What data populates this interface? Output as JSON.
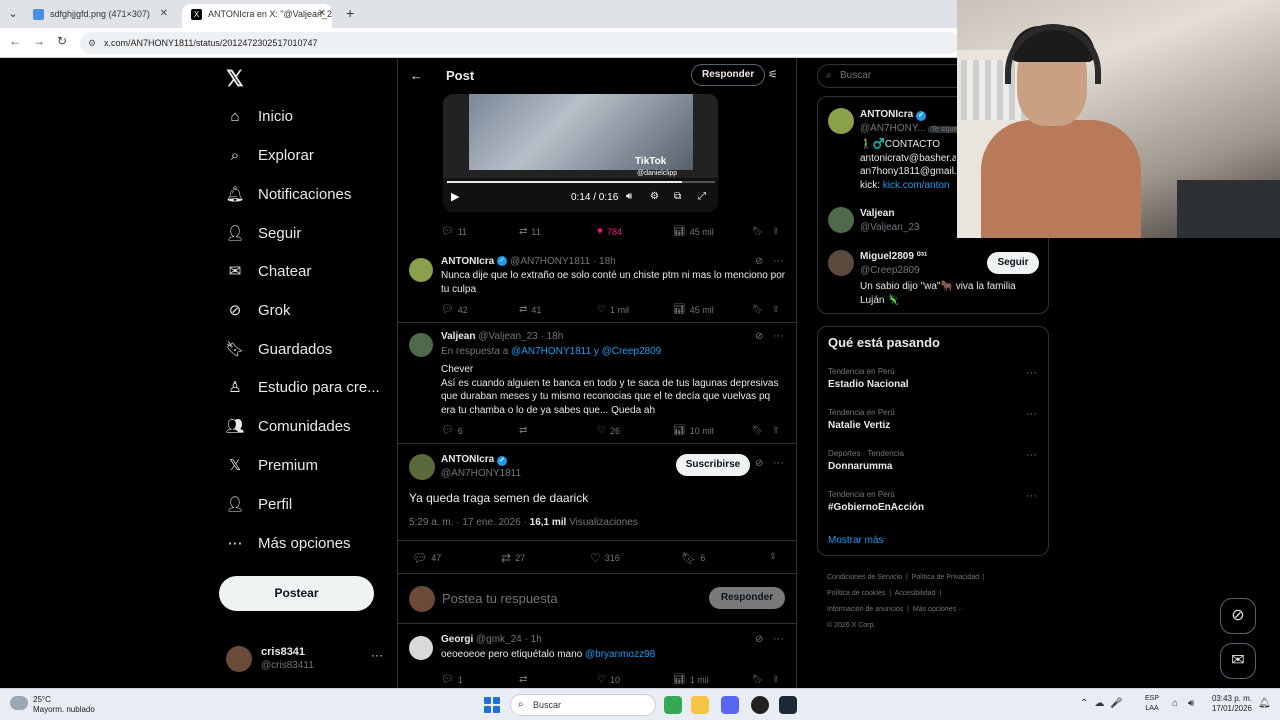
{
  "browser": {
    "tabs": [
      {
        "title": "sdfghjjgfd.png (471×307)",
        "active": false
      },
      {
        "title": "ANTONIcra en X: \"@Valjean_23",
        "active": true
      }
    ],
    "url": "x.com/AN7HONY1811/status/2012472302517010747"
  },
  "nav": {
    "items": [
      {
        "label": "Inicio",
        "icon": "home-icon",
        "glyph": "⌂"
      },
      {
        "label": "Explorar",
        "icon": "search-icon",
        "glyph": "⌕"
      },
      {
        "label": "Notificaciones",
        "icon": "bell-icon",
        "glyph": "🔔︎"
      },
      {
        "label": "Seguir",
        "icon": "add-user-icon",
        "glyph": "👤︎"
      },
      {
        "label": "Chatear",
        "icon": "mail-icon",
        "glyph": "✉"
      },
      {
        "label": "Grok",
        "icon": "grok-icon",
        "glyph": "⊘"
      },
      {
        "label": "Guardados",
        "icon": "bookmark-icon",
        "glyph": "🔖︎"
      },
      {
        "label": "Estudio para cre...",
        "icon": "studio-icon",
        "glyph": "♙"
      },
      {
        "label": "Comunidades",
        "icon": "communities-icon",
        "glyph": "👥︎"
      },
      {
        "label": "Premium",
        "icon": "x-icon",
        "glyph": "𝕏"
      },
      {
        "label": "Perfil",
        "icon": "profile-icon",
        "glyph": "👤︎"
      },
      {
        "label": "Más opciones",
        "icon": "more-circle-icon",
        "glyph": "⋯"
      }
    ],
    "post_button": "Postear",
    "me": {
      "name": "cris8341",
      "handle": "@cris83411"
    }
  },
  "header": {
    "title": "Post",
    "reply_button": "Responder"
  },
  "video": {
    "tiktok": "TikTok",
    "tiktok_handle": "@danielclipp",
    "time": "0:14 / 0:16",
    "progress": 0.875
  },
  "video_actions": {
    "replies": "11",
    "reposts": "11",
    "likes": "784",
    "views": "45 mil"
  },
  "tweets": [
    {
      "name": "ANTONIcra",
      "handle": "@AN7HONY1811 · 18h",
      "text": "Nunca dije que lo extraño oe solo conté un chiste ptm ni mas lo menciono por tu culpa",
      "replies": "42",
      "reposts": "41",
      "likes": "1 mil",
      "views": "45 mil"
    },
    {
      "name": "Valjean",
      "handle": "@Valjean_23 · 18h",
      "reply_prefix": "En respuesta a",
      "reply_users": "@AN7HONY1811 y @Creep2809",
      "text": "Chever\nAsí es cuando alguien te banca en todo y te saca de tus lagunas depresivas que duraban meses y tu mismo reconocias que el te decía que vuelvas pq era tu chamba o lo de ya sabes que... Queda ah",
      "replies": "6",
      "reposts": "",
      "likes": "26",
      "views": "10 mil"
    }
  ],
  "main_tweet": {
    "name": "ANTONIcra",
    "handle": "@AN7HONY1811",
    "subscribe": "Suscribirse",
    "text": "Ya queda traga semen de daarick",
    "timestamp": "5:29 a. m. · 17 ene. 2026 ·",
    "views_count": "16,1 mil",
    "views_label": "Visualizaciones",
    "replies": "47",
    "reposts": "27",
    "likes": "316",
    "bookmarks": "6"
  },
  "composer": {
    "placeholder": "Postea tu respuesta",
    "button": "Responder"
  },
  "bottom_tweet": {
    "name": "Georgi",
    "handle": "@gmk_24 · 1h",
    "text": "oeoeoeoe pero etiquétalo mano",
    "mention": "@bryanmozz98",
    "replies": "1",
    "likes": "10",
    "views": "1 mil"
  },
  "search": {
    "placeholder": "Buscar"
  },
  "related": [
    {
      "name": "ANTONIcra",
      "handle": "@AN7HONY...",
      "follows_you": "Te sigue",
      "bio_lines": [
        "🚶‍♂️♂️CONTACTO",
        "antonicratv@basher.a",
        "an7hony1811@gmail.c"
      ],
      "bio_link_prefix": "kick:",
      "bio_link": "kick.com/anton"
    },
    {
      "name": "Valjean",
      "handle": "@Valjean_23"
    },
    {
      "name": "Miguel2809 ⁰³¹",
      "handle": "@Creep2809",
      "follow_button": "Seguir",
      "bio_lines": [
        "Un sabio dijo \"wa\"🐂 viva la familia",
        "Luján 🦎"
      ]
    }
  ],
  "trends": {
    "title": "Qué está pasando",
    "items": [
      {
        "category": "Tendencia en Perú",
        "name": "Estadio Nacional"
      },
      {
        "category": "Tendencia en Perú",
        "name": "Natalie Vertiz"
      },
      {
        "category": "Deportes · Tendencia",
        "name": "Donnarumma"
      },
      {
        "category": "Tendencia en Perú",
        "name": "#GobiernoEnAcción"
      }
    ],
    "show_more": "Mostrar más"
  },
  "footer": {
    "links": [
      "Condiciones de Servicio",
      "Política de Privacidad",
      "Política de cookies",
      "Accesibilidad",
      "Información de anuncios",
      "Más opciones ···"
    ],
    "copyright": "© 2026 X Corp."
  },
  "taskbar": {
    "weather_temp": "25°C",
    "weather_cond": "Mayorm. nublado",
    "search": "Buscar",
    "lang_1": "ESP",
    "lang_2": "LAA",
    "time": "03:43 p. m.",
    "date": "17/01/2026"
  }
}
